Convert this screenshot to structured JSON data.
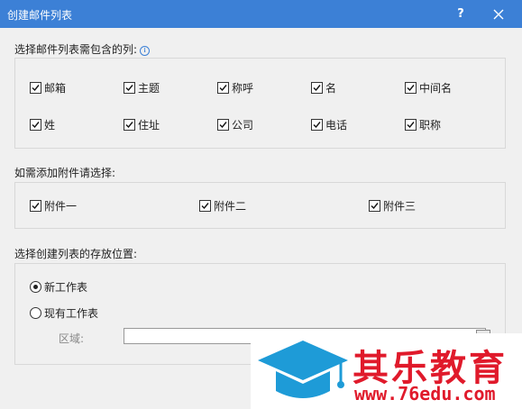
{
  "window": {
    "title": "创建邮件列表",
    "help_label": "?"
  },
  "columns_section": {
    "label": "选择邮件列表需包含的列:",
    "info_icon": "i",
    "items": [
      {
        "label": "邮箱",
        "checked": true
      },
      {
        "label": "主题",
        "checked": true
      },
      {
        "label": "称呼",
        "checked": true
      },
      {
        "label": "名",
        "checked": true
      },
      {
        "label": "中间名",
        "checked": true
      },
      {
        "label": "姓",
        "checked": true
      },
      {
        "label": "住址",
        "checked": true
      },
      {
        "label": "公司",
        "checked": true
      },
      {
        "label": "电话",
        "checked": true
      },
      {
        "label": "职称",
        "checked": true
      }
    ]
  },
  "attachments_section": {
    "label": "如需添加附件请选择:",
    "items": [
      {
        "label": "附件一",
        "checked": true
      },
      {
        "label": "附件二",
        "checked": true
      },
      {
        "label": "附件三",
        "checked": true
      }
    ]
  },
  "location_section": {
    "label": "选择创建列表的存放位置:",
    "options": [
      {
        "label": "新工作表",
        "selected": true
      },
      {
        "label": "现有工作表",
        "selected": false
      }
    ],
    "region_label": "区域:",
    "region_value": ""
  },
  "watermark": {
    "brand": "其乐教育",
    "url": "www.76edu.com",
    "colors": {
      "brand": "#e01a2b",
      "logo": "#1e9bd7"
    }
  }
}
